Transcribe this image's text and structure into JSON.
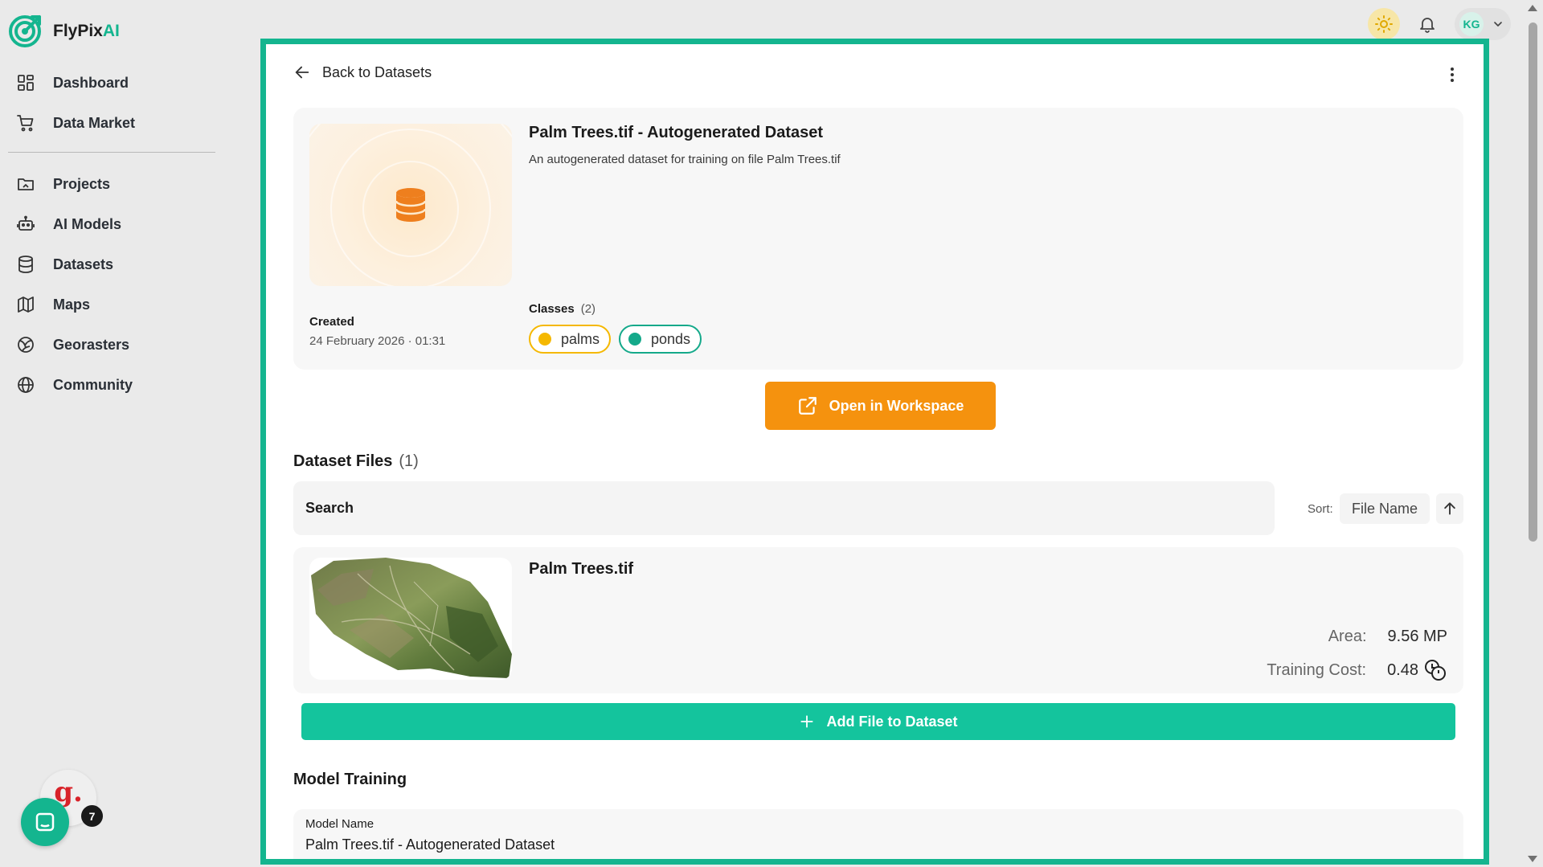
{
  "app": {
    "brand_prefix": "FlyPix",
    "brand_suffix": "AI"
  },
  "sidebar": {
    "primary": [
      {
        "label": "Dashboard",
        "icon": "dashboard-icon"
      },
      {
        "label": "Data Market",
        "icon": "cart-icon"
      }
    ],
    "secondary": [
      {
        "label": "Projects",
        "icon": "folder-icon"
      },
      {
        "label": "AI Models",
        "icon": "robot-icon"
      },
      {
        "label": "Datasets",
        "icon": "database-icon"
      },
      {
        "label": "Maps",
        "icon": "map-icon"
      },
      {
        "label": "Georasters",
        "icon": "globe-grid-icon"
      },
      {
        "label": "Community",
        "icon": "globe-icon"
      }
    ]
  },
  "widgets": {
    "notification_count": "7",
    "g_logo": "g."
  },
  "topbar": {
    "user_initials": "KG",
    "colors": {
      "theme_bg": "#f7e6a7",
      "accent": "#14b58f"
    }
  },
  "page": {
    "back_label": "Back to Datasets",
    "dataset": {
      "title": "Palm Trees.tif - Autogenerated Dataset",
      "description": "An autogenerated dataset for training on file Palm Trees.tif",
      "created_label": "Created",
      "created_value": "24 February 2026 · 01:31",
      "classes_label": "Classes",
      "classes_count": "(2)",
      "classes": [
        {
          "name": "palms",
          "color": "#f5b800"
        },
        {
          "name": "ponds",
          "color": "#14a98a"
        }
      ]
    },
    "open_button": "Open in Workspace",
    "files": {
      "title": "Dataset Files",
      "count": "(1)",
      "search_placeholder": "Search",
      "sort_label": "Sort:",
      "sort_value": "File Name",
      "items": [
        {
          "name": "Palm Trees.tif",
          "area_label": "Area:",
          "area_value": "9.56 MP",
          "cost_label": "Training Cost:",
          "cost_value": "0.48"
        }
      ]
    },
    "add_file_button": "Add File to Dataset",
    "training": {
      "title": "Model Training",
      "model_name_label": "Model Name",
      "model_name_value": "Palm Trees.tif - Autogenerated Dataset"
    },
    "colors": {
      "primary_orange": "#f5920e",
      "primary_green": "#14c49d",
      "frame": "#14b58f"
    }
  }
}
